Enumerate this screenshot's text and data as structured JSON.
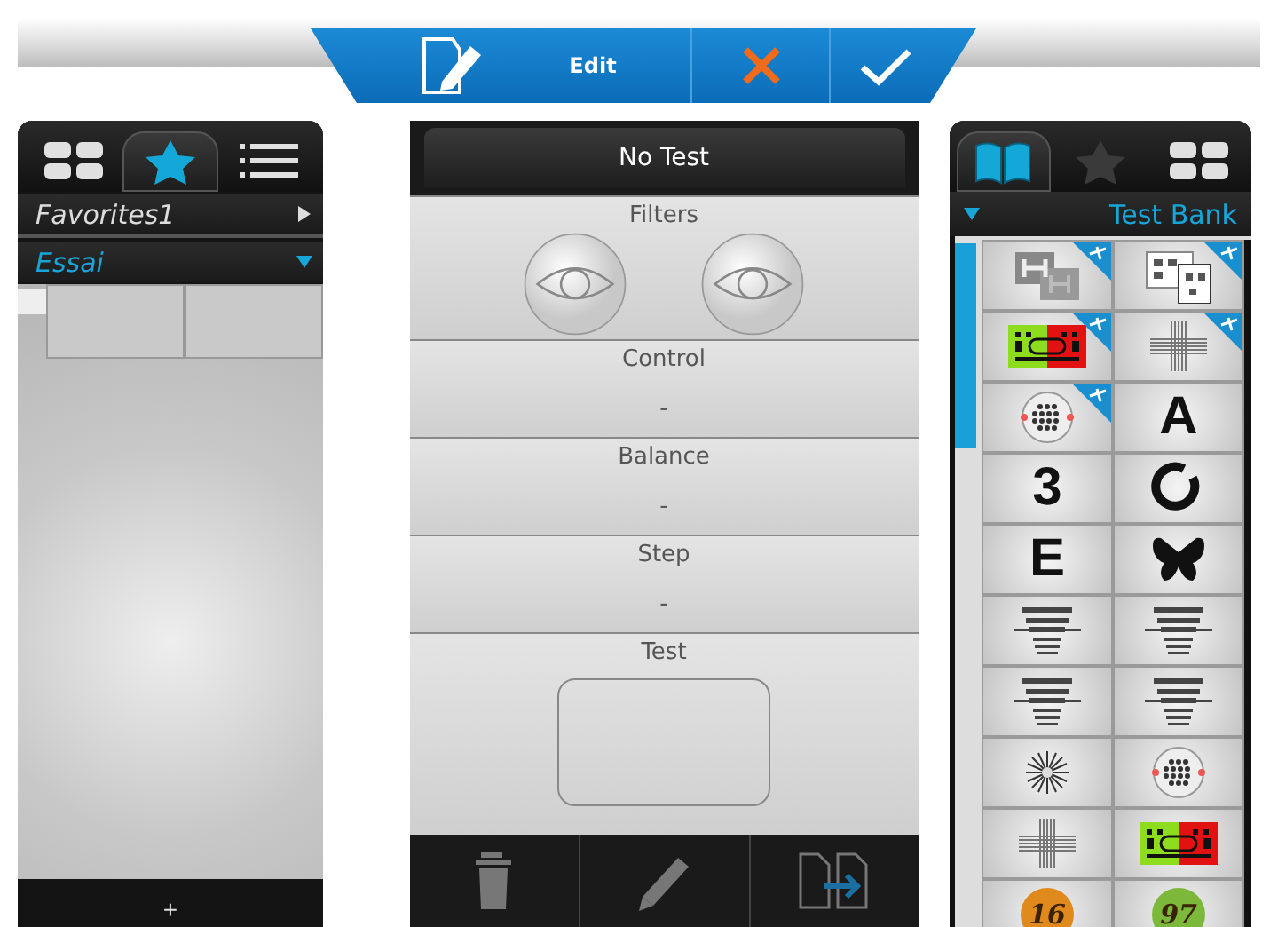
{
  "toolbar": {
    "buttons": [
      {
        "kind": "edit",
        "label": "Edit"
      },
      {
        "kind": "cancel"
      },
      {
        "kind": "confirm"
      }
    ]
  },
  "left_panel": {
    "tabs": [
      {
        "kind": "grid",
        "selected": false
      },
      {
        "kind": "star",
        "selected": true
      },
      {
        "kind": "list",
        "selected": false
      }
    ],
    "lists": [
      {
        "label": "Favorites1",
        "expanded": false,
        "selected": false
      },
      {
        "label": "Essai",
        "expanded": true,
        "selected": true
      }
    ],
    "add_button": "+"
  },
  "center_panel": {
    "title": "No Test",
    "sections": [
      {
        "kind": "filters",
        "title": "Filters"
      },
      {
        "kind": "value",
        "title": "Control",
        "value": "-"
      },
      {
        "kind": "value",
        "title": "Balance",
        "value": "-"
      },
      {
        "kind": "value",
        "title": "Step",
        "value": "-"
      },
      {
        "kind": "test",
        "title": "Test"
      }
    ],
    "actions": [
      {
        "kind": "delete"
      },
      {
        "kind": "edit"
      },
      {
        "kind": "copy"
      }
    ]
  },
  "right_panel": {
    "tabs": [
      {
        "kind": "book",
        "selected": true
      },
      {
        "kind": "star",
        "selected": false
      },
      {
        "kind": "grid",
        "selected": false
      }
    ],
    "dropdown": "Test Bank",
    "tiles": [
      {
        "kind": "h-chart",
        "flagged": true
      },
      {
        "kind": "letter-chart",
        "flagged": true
      },
      {
        "kind": "duochrome",
        "flagged": true
      },
      {
        "kind": "cross",
        "flagged": true
      },
      {
        "kind": "dot-target",
        "flagged": true
      },
      {
        "kind": "letter",
        "text": "A",
        "flagged": false
      },
      {
        "kind": "letter",
        "text": "3",
        "flagged": false
      },
      {
        "kind": "ring",
        "flagged": false
      },
      {
        "kind": "letter",
        "text": "E",
        "flagged": false
      },
      {
        "kind": "butterfly",
        "flagged": false
      },
      {
        "kind": "acuity-chart",
        "flagged": false
      },
      {
        "kind": "acuity-chart",
        "flagged": false
      },
      {
        "kind": "acuity-chart",
        "flagged": false
      },
      {
        "kind": "acuity-chart",
        "flagged": false
      },
      {
        "kind": "radial",
        "flagged": false
      },
      {
        "kind": "dot-target",
        "flagged": false
      },
      {
        "kind": "cross",
        "flagged": false
      },
      {
        "kind": "duochrome",
        "flagged": false
      },
      {
        "kind": "plate",
        "text": "16",
        "color": "#e08a1e",
        "flagged": false
      },
      {
        "kind": "plate",
        "text": "97",
        "color": "#7cb83a",
        "flagged": false
      }
    ]
  }
}
